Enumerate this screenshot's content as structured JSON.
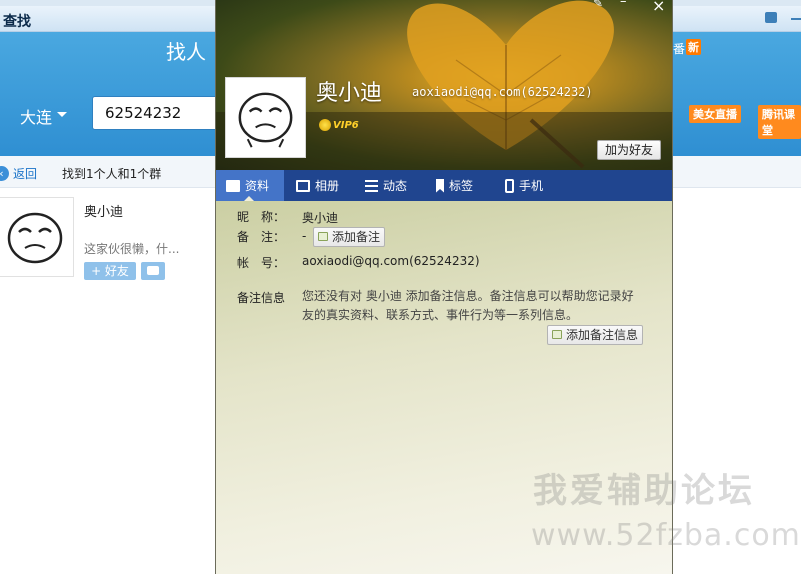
{
  "background_window": {
    "title": "查找",
    "header_title": "找人",
    "city": "大连",
    "search_value": "62524232",
    "result_back": "返回",
    "result_count": "找到1个人和1个群",
    "right_chrome": {
      "new_badge": "新",
      "fan_text": "番",
      "promo_1": "美女直播",
      "promo_2": "腾讯课堂"
    },
    "result_card": {
      "name": "奥小迪",
      "description": "这家伙很懒，什...",
      "add_button": "+ 好友"
    }
  },
  "profile": {
    "name": "奥小迪",
    "account_header": "aoxiaodi@qq.com(62524232)",
    "vip_label": "VIP6",
    "add_friend_button": "加为好友",
    "tabs": [
      {
        "label": "资料",
        "icon": "profile-card-icon"
      },
      {
        "label": "相册",
        "icon": "album-icon"
      },
      {
        "label": "动态",
        "icon": "feed-list-icon"
      },
      {
        "label": "标签",
        "icon": "tag-icon"
      },
      {
        "label": "手机",
        "icon": "phone-icon"
      }
    ],
    "fields": {
      "nickname_label": "昵　称：",
      "nickname_value": "奥小迪",
      "remark_label": "备　注：",
      "remark_value": "-",
      "remark_button": "添加备注",
      "account_label": "帐　号：",
      "account_value": "aoxiaodi@qq.com(62524232)",
      "remark_info_label": "备注信息",
      "remark_info_text": "您还没有对 奥小迪 添加备注信息。备注信息可以帮助您记录好友的真实资料、联系方式、事件行为等一系列信息。",
      "remark_info_button": "添加备注信息"
    }
  },
  "watermark": {
    "text_cn": "我爱辅助论坛",
    "text_url": "www.52fzba.com"
  },
  "colors": {
    "tabbar": "#20458f",
    "tab_active": "#4474c8",
    "header_blue": "#2f8fd2"
  }
}
